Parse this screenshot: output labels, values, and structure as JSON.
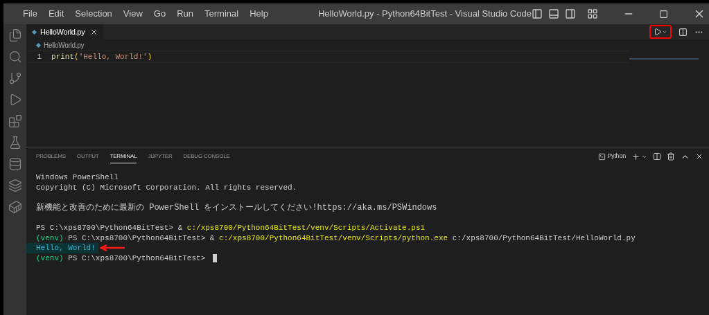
{
  "menu": [
    "File",
    "Edit",
    "Selection",
    "View",
    "Go",
    "Run",
    "Terminal",
    "Help"
  ],
  "window": {
    "title": "HelloWorld.py - Python64BitTest - Visual Studio Code"
  },
  "activity_bar": [
    {
      "kind": "files",
      "selected": false
    },
    {
      "kind": "search",
      "selected": false
    },
    {
      "kind": "source-control",
      "selected": false
    },
    {
      "kind": "run-debug",
      "selected": false
    },
    {
      "kind": "extensions",
      "selected": false
    },
    {
      "kind": "testing",
      "selected": false
    },
    {
      "kind": "database",
      "selected": false
    },
    {
      "kind": "layers",
      "selected": false
    },
    {
      "kind": "docker",
      "selected": false
    }
  ],
  "editor_tabs": [
    {
      "label": "HelloWorld.py",
      "selected": true
    }
  ],
  "run_button": {
    "annotated": true
  },
  "breadcrumb": "HelloWorld.py",
  "code": [
    {
      "number": "1",
      "tokens": [
        {
          "text": "print",
          "kind": "func"
        },
        {
          "text": "(",
          "kind": "paren"
        },
        {
          "text": "'Hello, World!'",
          "kind": "string"
        },
        {
          "text": ")",
          "kind": "paren"
        }
      ]
    }
  ],
  "panel_tabs": [
    {
      "label": "PROBLEMS",
      "selected": false
    },
    {
      "label": "OUTPUT",
      "selected": false
    },
    {
      "label": "TERMINAL",
      "selected": true
    },
    {
      "label": "JUPYTER",
      "selected": false
    },
    {
      "label": "DEBUG CONSOLE",
      "selected": false
    }
  ],
  "terminal_name": "Python",
  "terminal": [
    {
      "lines": [
        {
          "segments": [
            {
              "text": "Windows PowerShell",
              "kind": "plain"
            }
          ]
        },
        {
          "segments": [
            {
              "text": "Copyright (C) Microsoft Corporation. All rights reserved.",
              "kind": "plain"
            }
          ]
        }
      ]
    },
    {
      "lines": [
        {
          "segments": [
            {
              "text": "新機能と改善のために最新の PowerShell をインストールしてください!https://aka.ms/PSWindows",
              "kind": "notice"
            }
          ]
        }
      ]
    },
    {
      "lines": [
        {
          "segments": [
            {
              "text": "PS C:\\xps8700\\Python64BitTest> & ",
              "kind": "plain"
            },
            {
              "text": "c:/xps8700/Python64BitTest/venv/Scripts/Activate.ps1",
              "kind": "path"
            }
          ]
        },
        {
          "segments": [
            {
              "text": "(venv) ",
              "kind": "venv"
            },
            {
              "text": "PS C:\\xps8700\\Python64BitTest> & ",
              "kind": "plain"
            },
            {
              "text": "c:/xps8700/Python64BitTest/venv/Scripts/python.exe",
              "kind": "path"
            },
            {
              "text": " c:/xps8700/Python64BitTest/HelloWorld.py",
              "kind": "plain"
            }
          ]
        },
        {
          "highlighted": true,
          "annotated": true,
          "segments": [
            {
              "text": "Hello, World!",
              "kind": "output"
            }
          ]
        },
        {
          "cursor": true,
          "segments": [
            {
              "text": "(venv) ",
              "kind": "venv"
            },
            {
              "text": "PS C:\\xps8700\\Python64BitTest> ",
              "kind": "plain"
            }
          ]
        }
      ]
    }
  ]
}
